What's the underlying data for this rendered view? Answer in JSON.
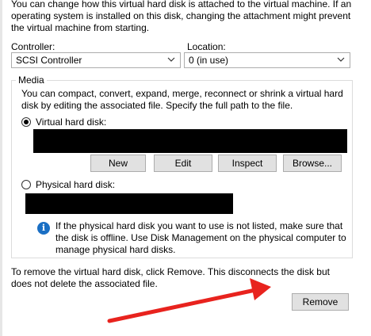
{
  "intro_text": "You can change how this virtual hard disk is attached to the virtual machine. If an operating system is installed on this disk, changing the attachment might prevent the virtual machine from starting.",
  "controller": {
    "label": "Controller:",
    "value": "SCSI Controller"
  },
  "location": {
    "label": "Location:",
    "value": "0 (in use)"
  },
  "media": {
    "legend": "Media",
    "description": "You can compact, convert, expand, merge, reconnect or shrink a virtual hard disk by editing the associated file. Specify the full path to the file.",
    "virtual_label": "Virtual hard disk:",
    "virtual_selected": true,
    "buttons": {
      "new": "New",
      "edit": "Edit",
      "inspect": "Inspect",
      "browse": "Browse..."
    },
    "physical_label": "Physical hard disk:",
    "physical_selected": false,
    "info_text": "If the physical hard disk you want to use is not listed, make sure that the disk is offline. Use Disk Management on the physical computer to manage physical hard disks."
  },
  "remove_text": "To remove the virtual hard disk, click Remove. This disconnects the disk but does not delete the associated file.",
  "remove_button": "Remove",
  "colors": {
    "info_icon": "#1a6fc4",
    "arrow": "#e8231e"
  },
  "icons": {
    "info": "info-icon",
    "dropdown": "chevron-down-icon",
    "arrow": "red-arrow-annotation"
  }
}
